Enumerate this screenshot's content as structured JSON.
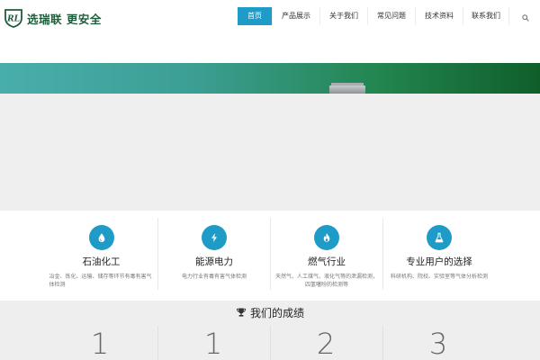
{
  "brand": {
    "mark": "RL",
    "name": "选瑞联 更安全",
    "accent": "#1e9bc7",
    "logo_color": "#1e5d3b"
  },
  "nav": {
    "items": [
      {
        "label": "首页",
        "active": true
      },
      {
        "label": "产品展示",
        "active": false
      },
      {
        "label": "关于我们",
        "active": false
      },
      {
        "label": "常见问题",
        "active": false
      },
      {
        "label": "技术资料",
        "active": false
      },
      {
        "label": "联系我们",
        "active": false
      }
    ],
    "search_icon": "search-icon"
  },
  "features": [
    {
      "icon": "water-drop-icon",
      "title": "石油化工",
      "desc": "冶金、炼化、运输、储存等环节有毒有害气体检测"
    },
    {
      "icon": "lightning-icon",
      "title": "能源电力",
      "desc": "电力行业有毒有害气体检测"
    },
    {
      "icon": "flame-icon",
      "title": "燃气行业",
      "desc": "天然气、人工煤气、液化气等的泄漏检测，四氢噻吩的检测等"
    },
    {
      "icon": "flask-icon",
      "title": "专业用户的选择",
      "desc": "科研机构、院校、实验室等气体分析检测"
    }
  ],
  "achievements": {
    "icon": "trophy-icon",
    "title": "我们的成绩",
    "stats": [
      "1",
      "1",
      "2",
      "3"
    ]
  }
}
